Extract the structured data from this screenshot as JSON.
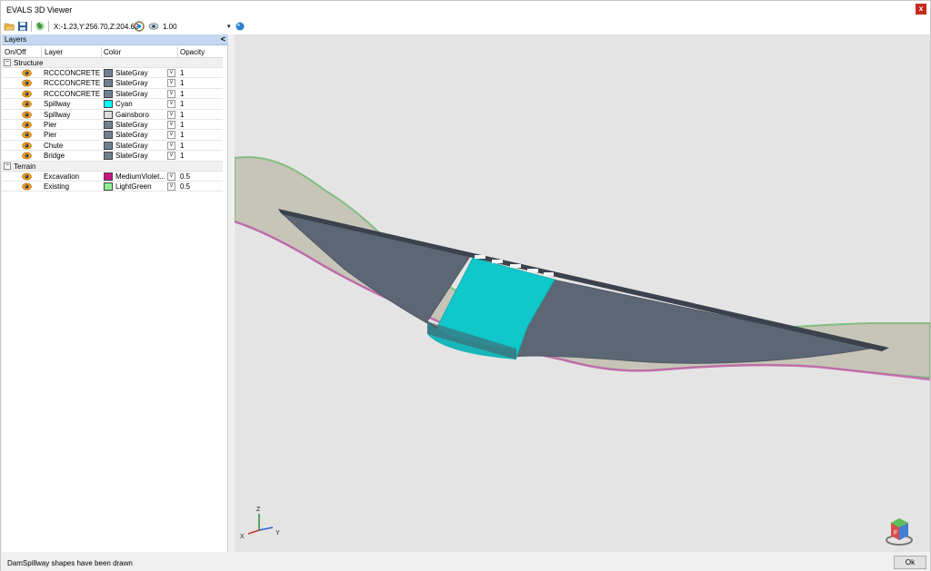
{
  "window": {
    "title": "EVALS 3D Viewer",
    "close_label": "x"
  },
  "toolbar": {
    "coordinates": "X:-1.23,Y:256.70,Z:204.62",
    "zoom_value": "1.00",
    "zoom_dropdown": "▾",
    "icons": [
      "open-folder-icon",
      "save-icon",
      "refresh-icon",
      "color-wheel-icon",
      "eye-icon",
      "sphere-icon"
    ]
  },
  "layers_panel": {
    "title": "Layers",
    "collapse_label": "<",
    "columns": [
      "On/Off",
      "Layer",
      "Color",
      "Opacity"
    ],
    "groups": [
      {
        "name": "Structure",
        "expander": "−",
        "rows": [
          {
            "layer": "RCCCONCRETE",
            "color_name": "SlateGray",
            "color": "#708090",
            "opacity": "1"
          },
          {
            "layer": "RCCCONCRETE",
            "color_name": "SlateGray",
            "color": "#708090",
            "opacity": "1"
          },
          {
            "layer": "RCCCONCRETE",
            "color_name": "SlateGray",
            "color": "#708090",
            "opacity": "1"
          },
          {
            "layer": "Spillway",
            "color_name": "Cyan",
            "color": "#00ffff",
            "opacity": "1"
          },
          {
            "layer": "Spillway",
            "color_name": "Gainsboro",
            "color": "#dcdcdc",
            "opacity": "1"
          },
          {
            "layer": "Pier",
            "color_name": "SlateGray",
            "color": "#708090",
            "opacity": "1"
          },
          {
            "layer": "Pier",
            "color_name": "SlateGray",
            "color": "#708090",
            "opacity": "1"
          },
          {
            "layer": "Chute",
            "color_name": "SlateGray",
            "color": "#708090",
            "opacity": "1"
          },
          {
            "layer": "Bridge",
            "color_name": "SlateGray",
            "color": "#708090",
            "opacity": "1"
          }
        ]
      },
      {
        "name": "Terrain",
        "expander": "−",
        "rows": [
          {
            "layer": "Excavation",
            "color_name": "MediumViolet...",
            "color": "#c71585",
            "opacity": "0.5"
          },
          {
            "layer": "Existing",
            "color_name": "LightGreen",
            "color": "#90ee90",
            "opacity": "0.5"
          }
        ]
      }
    ]
  },
  "viewport": {
    "background": "#e5e4e4",
    "axes": {
      "z": "Z",
      "x": "X",
      "y": "Y"
    },
    "view_cube_label": "F"
  },
  "status": {
    "message": "DamSpillway shapes have been drawn",
    "ok_label": "Ok"
  }
}
